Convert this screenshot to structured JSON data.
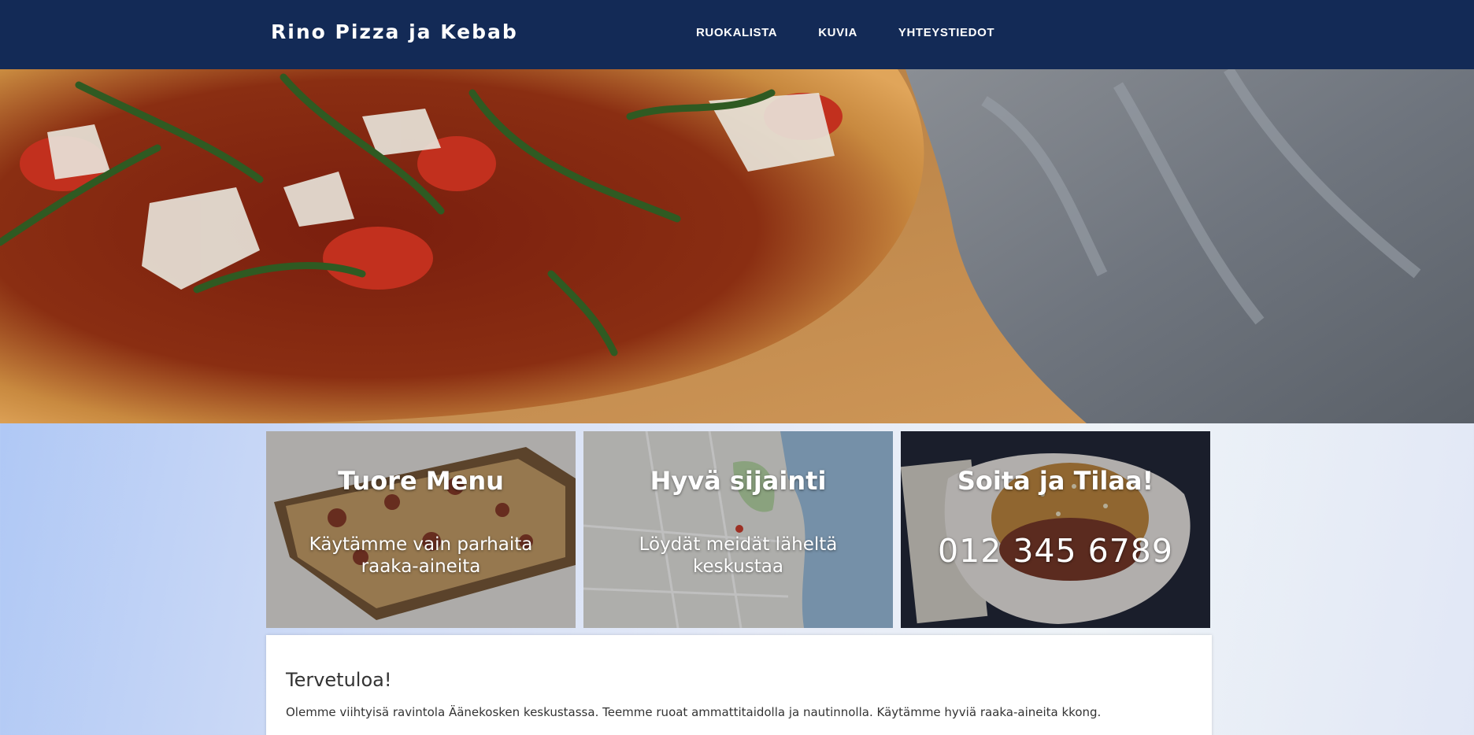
{
  "header": {
    "brand": "Rino Pizza ja Kebab",
    "nav": [
      "RUOKALISTA",
      "KUVIA",
      "YHTEYSTIEDOT"
    ]
  },
  "hero": {
    "image": "pizza-photo"
  },
  "cards": [
    {
      "title": "Tuore Menu",
      "text": "Käytämme vain parhaita raaka-aineita",
      "image": "flatbread-photo"
    },
    {
      "title": "Hyvä sijainti",
      "text": "Löydät meidät läheltä keskustaa",
      "image": "map-photo"
    },
    {
      "title": "Soita ja Tilaa!",
      "phone": "012 345 6789",
      "image": "burger-photo"
    }
  ],
  "welcome": {
    "title": "Tervetuloa!",
    "text": "Olemme viihtyisä ravintola Äänekosken keskustassa. Teemme ruoat ammattitaidolla ja nautinnolla. Käytämme hyviä raaka-aineita kkong."
  },
  "colors": {
    "header_bg": "#132a56",
    "text_dark": "#333333"
  }
}
